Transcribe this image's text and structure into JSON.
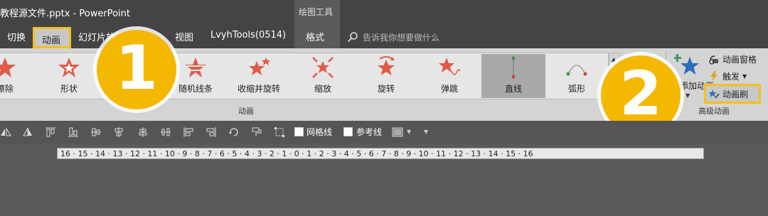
{
  "window": {
    "title": "教程源文件.pptx  -  PowerPoint",
    "tool_context_header": "绘图工具"
  },
  "tabs": {
    "items": [
      "切换",
      "幻灯片放映",
      "视图",
      "LvyhTools(0514)",
      "格式"
    ],
    "active": "动画",
    "search_placeholder": "告诉我你想要做什么"
  },
  "ribbon": {
    "effects": [
      {
        "label": "擦除",
        "icon": "wipe-star-icon"
      },
      {
        "label": "形状",
        "icon": "shape-star-icon"
      },
      {
        "label": "随机线条",
        "icon": "random-bars-star-icon"
      },
      {
        "label": "收缩并旋转",
        "icon": "shrink-turn-star-icon"
      },
      {
        "label": "缩放",
        "icon": "zoom-star-icon"
      },
      {
        "label": "旋转",
        "icon": "spin-star-icon"
      },
      {
        "label": "弹跳",
        "icon": "bounce-star-icon"
      },
      {
        "label": "直线",
        "icon": "line-path-icon",
        "selected": true
      },
      {
        "label": "弧形",
        "icon": "arc-path-icon"
      }
    ],
    "animation_group_label": "动画",
    "advanced": {
      "group_label": "高级动画",
      "add_animation": "添加动画",
      "animation_pane": "动画窗格",
      "trigger": "触发",
      "animation_painter": "动画刷"
    }
  },
  "callouts": [
    "1",
    "2"
  ],
  "toolbar": {
    "gridlines": "网格线",
    "guides": "参考线"
  },
  "ruler": {
    "ticks": "16 · 15 · 14 · 13 · 12 · 11 · 10 · 9 · 8 · 7 · 6 · 5 · 4 · 3 · 2 · 1 · 0 · 1 · 2 · 3 · 4 · 5 · 6 · 7 · 8 · 9 · 10 · 11 · 12 · 13 · 14 · 15 · 16"
  },
  "colors": {
    "effect_red": "#e05a47",
    "highlight": "#f2c11b",
    "callout": "#f5b800",
    "add_star": "#2a6ebb"
  }
}
